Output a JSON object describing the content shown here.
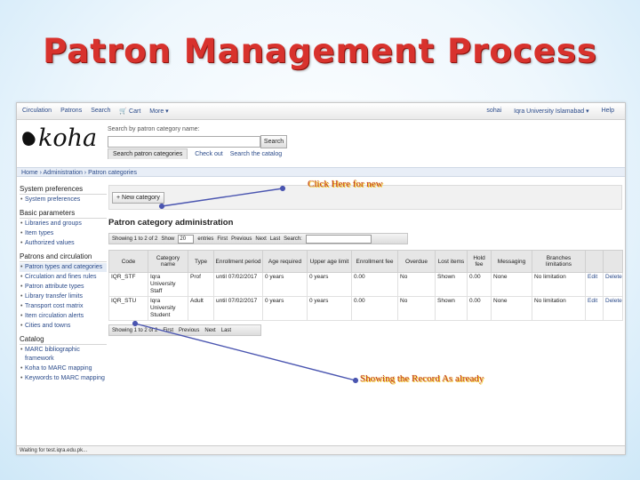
{
  "slide": {
    "title": "Patron Management Process"
  },
  "navbar": {
    "left": [
      "Circulation",
      "Patrons",
      "Search",
      "🛒 Cart",
      "More ▾"
    ],
    "user": "sohai",
    "branch": "Iqra University Islamabad ▾",
    "help": "Help"
  },
  "logo": {
    "text": "koha"
  },
  "search": {
    "label": "Search by patron category name:",
    "placeholder": "",
    "button": "Search",
    "tabs": [
      "Search patron categories",
      "Check out",
      "Search the catalog"
    ]
  },
  "breadcrumb": "Home › Administration › Patron categories",
  "sidebar": {
    "sections": [
      {
        "title": "System preferences",
        "items": [
          "System preferences"
        ]
      },
      {
        "title": "Basic parameters",
        "items": [
          "Libraries and groups",
          "Item types",
          "Authorized values"
        ]
      },
      {
        "title": "Patrons and circulation",
        "items": [
          "Patron types and categories",
          "Circulation and fines rules",
          "Patron attribute types",
          "Library transfer limits",
          "Transport cost matrix",
          "Item circulation alerts",
          "Cities and towns"
        ]
      },
      {
        "title": "Catalog",
        "items": [
          "MARC bibliographic framework",
          "Koha to MARC mapping",
          "Keywords to MARC mapping"
        ]
      }
    ]
  },
  "toolbar": {
    "new_label": "+ New category"
  },
  "main": {
    "title": "Patron category administration",
    "dt_top": {
      "info": "Showing 1 to 2 of 2",
      "show_label": "Show",
      "show_value": "20",
      "entries": "entries",
      "first": "First",
      "previous": "Previous",
      "next": "Next",
      "last": "Last",
      "search_label": "Search:"
    },
    "columns": [
      "Code",
      "Category name",
      "Type",
      "Enrollment period",
      "Age required",
      "Upper age limit",
      "Enrollment fee",
      "Overdue",
      "Lost items",
      "Hold fee",
      "Messaging",
      "Branches limitations",
      "",
      ""
    ],
    "rows": [
      [
        "IQR_STF",
        "Iqra University Staff",
        "Prof",
        "until 07/02/2017",
        "0 years",
        "0 years",
        "0.00",
        "No",
        "Shown",
        "0.00",
        "None",
        "No limitation",
        "Edit",
        "Delete"
      ],
      [
        "IQR_STU",
        "Iqra University Student",
        "Adult",
        "until 07/02/2017",
        "0 years",
        "0 years",
        "0.00",
        "No",
        "Shown",
        "0.00",
        "None",
        "No limitation",
        "Edit",
        "Delete"
      ]
    ],
    "dt_bottom": {
      "info": "Showing 1 to 2 of 2",
      "first": "First",
      "previous": "Previous",
      "next": "Next",
      "last": "Last"
    }
  },
  "statusbar": "Waiting for test.iqra.edu.pk...",
  "annotations": {
    "new": "Click Here for new",
    "record": "Showing the Record As already"
  },
  "colors": {
    "title": "#d8322d",
    "link": "#2b4b8a",
    "annotation": "#c0392b",
    "arrow": "#4a55b0"
  }
}
